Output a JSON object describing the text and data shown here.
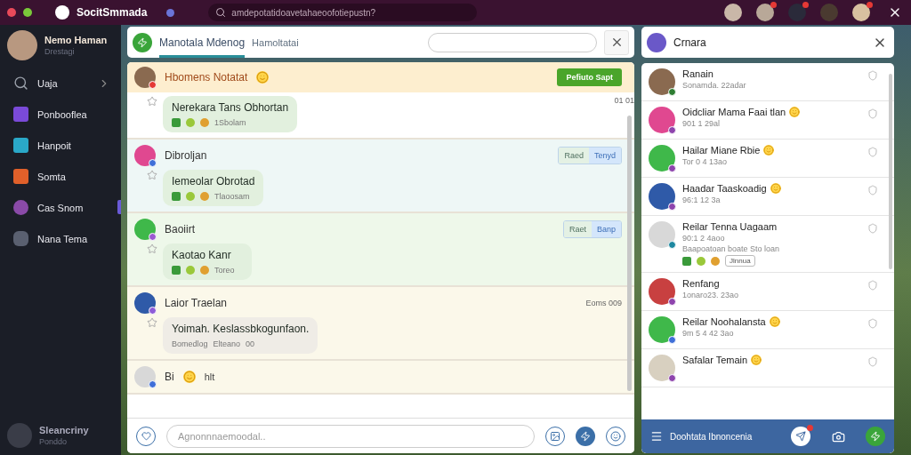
{
  "top_bar": {
    "app_name": "SocitSmmada",
    "search_placeholder": "amdepotatidoavetahaeoofotiepustn?",
    "avatars": [
      {
        "badge": false
      },
      {
        "badge": true
      },
      {
        "badge": true
      },
      {
        "badge": false
      },
      {
        "badge": true
      }
    ]
  },
  "sidebar": {
    "profile": {
      "name": "Nemo Haman",
      "subtitle": "Drestagi"
    },
    "items": [
      {
        "label": "Uaja",
        "expandable": true,
        "selected": false
      },
      {
        "label": "Ponbooflea",
        "expandable": false,
        "selected": false
      },
      {
        "label": "Hanpoit",
        "expandable": false,
        "selected": false
      },
      {
        "label": "Somta",
        "expandable": false,
        "selected": false
      },
      {
        "label": "Cas Snom",
        "expandable": false,
        "selected": true
      },
      {
        "label": "Nana Tema",
        "expandable": false,
        "selected": false
      }
    ],
    "footer": {
      "name": "Sleancriny",
      "subtitle": "Ponddo"
    }
  },
  "chat": {
    "title": "Manotala Mdenog",
    "subtitle": "Hamoltatai",
    "messages": [
      {
        "kind": "highlighted",
        "name": "Hbomens Notatat",
        "smiley": true,
        "color": "#e53935",
        "action": "Pefiuto Sapt",
        "time": "01 01",
        "text": "Nerekara Tans Obhortan",
        "meta": [
          "1Sbolam"
        ]
      },
      {
        "kind": "info",
        "name": "Dibroljan",
        "smiley": false,
        "color": "#3f6fd8",
        "tag": [
          "Raed",
          "Tenyd"
        ],
        "text": "Iemeolar Obrotad",
        "meta": [
          "Tlaoosam"
        ]
      },
      {
        "kind": "success",
        "name": "Baoiirt",
        "smiley": false,
        "color": "#9b59d0",
        "tag": [
          "Raet",
          "Banp"
        ],
        "text": "Kaotao Kanr",
        "meta": [
          "Toreo"
        ]
      },
      {
        "kind": "plain",
        "name": "Laior Traelan",
        "smiley": false,
        "color": "#8e5cd8",
        "time": "Eoms 009",
        "text": "Yoimah. Keslassbkogunfaon.",
        "meta": [
          "Bomedlog",
          "Elteano",
          "00"
        ]
      },
      {
        "kind": "partial",
        "name": "Bi",
        "smiley": true,
        "color": "#3f6fd8",
        "text": "hlt"
      }
    ],
    "composer_placeholder": "Agnonnnaemoodal.."
  },
  "contacts_panel": {
    "title": "Crnara",
    "contacts": [
      {
        "name": "Ranain",
        "subtitle": "Sonamda. 22adar",
        "smiley": false,
        "color": "#2e7d32"
      },
      {
        "name": "Oidcliar Mama Faai tlan",
        "subtitle": "901 1 29al",
        "smiley": true,
        "color": "#8e44ad"
      },
      {
        "name": "Hailar Miane Rbie",
        "subtitle": "Tor 0 4 13ao",
        "smiley": true,
        "color": "#8e44ad"
      },
      {
        "name": "Haadar Taaskoadig",
        "subtitle": "96:1 12 3a",
        "smiley": true,
        "color": "#8e44ad"
      },
      {
        "name": "Reilar Tenna Uagaam",
        "subtitle": "90:1 2 4aoo",
        "smiley": false,
        "color": "#1e88a0",
        "preview": "Baapoatoan boate Sto loan",
        "tag": "Jlnnua"
      },
      {
        "name": "Renfang",
        "subtitle": "1onaro23. 23ao",
        "smiley": false,
        "color": "#8e44ad"
      },
      {
        "name": "Reilar Noohalansta",
        "subtitle": "9m 5 4 42 3ao",
        "smiley": true,
        "color": "#3f6fd8"
      },
      {
        "name": "Safalar Temain",
        "smiley": true,
        "color": "#8e44ad"
      }
    ],
    "footer_label": "Doohtata Ibnoncenia",
    "notification_badge": true
  }
}
